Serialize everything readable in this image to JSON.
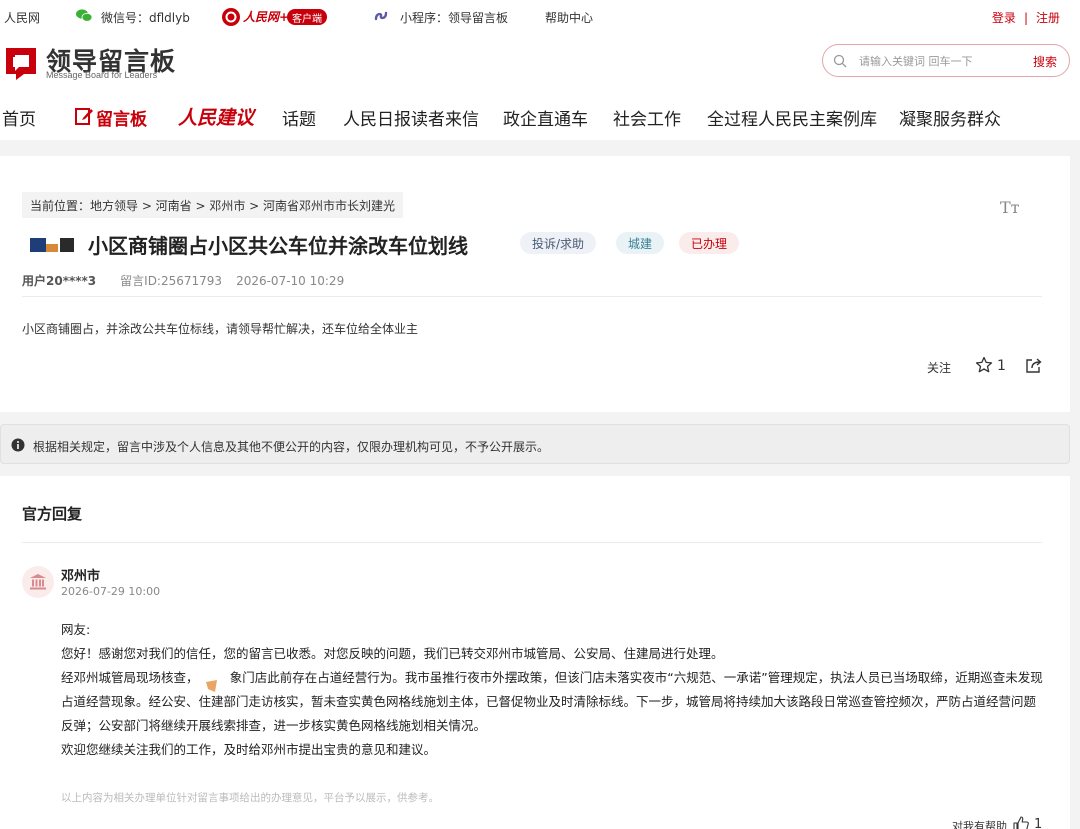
{
  "topbar": {
    "site": "人民网",
    "wechat": "微信号：dfldlyb",
    "rmw_client": "人民网+",
    "rmw_client_badge": "客户端",
    "miniprogram": "小程序：领导留言板",
    "help": "帮助中心",
    "login": "登录",
    "divider": "|",
    "register": "注册"
  },
  "header": {
    "logo_title": "领导留言板",
    "logo_subtitle": "Message Board for Leaders",
    "search_placeholder": "请输入关键词 回车一下",
    "search_button": "搜索",
    "brand_color": "#c7000b"
  },
  "nav": {
    "items": [
      "首页",
      "留言板",
      "人民建议",
      "话题",
      "人民日报读者来信",
      "政企直通车",
      "社会工作",
      "全过程人民民主案例库",
      "凝聚服务群众"
    ]
  },
  "message": {
    "breadcrumb": "当前位置：地方领导 > 河南省 > 邓州市 > 河南省邓州市市长刘建光",
    "title": "小区商铺圈占小区共公车位并涂改车位划线",
    "tags": [
      "投诉/求助",
      "城建",
      "已办理"
    ],
    "user": "用户20****3",
    "message_id": "留言ID:25671793",
    "datetime": "2026-07-10 10:29",
    "content": "小区商铺圈占，并涂改公共车位标线，请领导帮忙解决，还车位给全体业主",
    "follow_label": "关注",
    "star_count": "1",
    "font_toggle": "Tт"
  },
  "notice": {
    "text": "根据相关规定，留言中涉及个人信息及其他不便公开的内容，仅限办理机构可见，不予公开展示。"
  },
  "reply": {
    "section_title": "官方回复",
    "org": "邓州市",
    "time": "2026-07-29 10:00",
    "greeting": "网友:",
    "p1": "您好！感谢您对我们的信任，您的留言已收悉。对您反映的问题，我们已转交邓州市城管局、公安局、住建局进行处理。",
    "p2": "经邓州城管局现场核查，　　　象门店此前存在占道经营行为。我市虽推行夜市外摆政策，但该门店未落实夜市“六规范、一承诺”管理规定，执法人员已当场取缔，近期巡查未发现占道经营现象。经公安、住建部门走访核实，暂未查实黄色网格线施划主体，已督促物业及时清除标线。下一步，城管局将持续加大该路段日常巡查管控频次，严防占道经营问题反弹；公安部门将继续开展线索排查，进一步核实黄色网格线施划相关情况。",
    "p3": "欢迎您继续关注我们的工作，及时给邓州市提出宝贵的意见和建议。",
    "disclaimer": "以上内容为相关办理单位针对留言事项给出的办理意见，平台予以展示，供参考。",
    "helpful_label": "对我有帮助",
    "helpful_count": "1"
  }
}
